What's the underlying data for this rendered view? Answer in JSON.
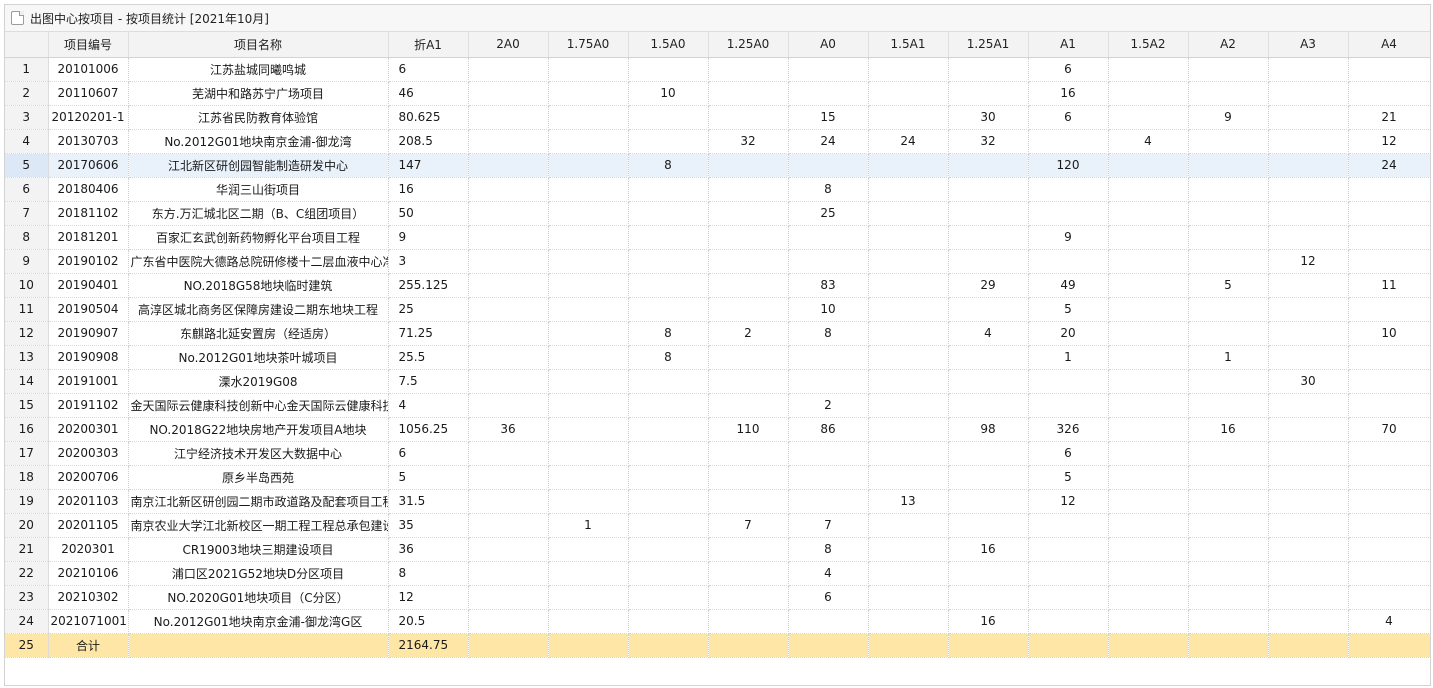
{
  "window": {
    "title": "出图中心按项目 - 按项目统计 [2021年10月]",
    "icon": "document-icon"
  },
  "columns": [
    "项目编号",
    "项目名称",
    "折A1",
    "2A0",
    "1.75A0",
    "1.5A0",
    "1.25A0",
    "A0",
    "1.5A1",
    "1.25A1",
    "A1",
    "1.5A2",
    "A2",
    "A3",
    "A4"
  ],
  "selected_row": 5,
  "rows": [
    {
      "rn": "1",
      "code": "20101006",
      "name": "江苏盐城同曦鸣城",
      "zhe": "6",
      "c2A0": "",
      "c175A0": "",
      "c15A0": "",
      "c125A0": "",
      "cA0": "",
      "c15A1": "",
      "c125A1": "",
      "cA1": "6",
      "c15A2": "",
      "cA2": "",
      "cA3": "",
      "cA4": ""
    },
    {
      "rn": "2",
      "code": "20110607",
      "name": "芜湖中和路苏宁广场项目",
      "zhe": "46",
      "c2A0": "",
      "c175A0": "",
      "c15A0": "10",
      "c125A0": "",
      "cA0": "",
      "c15A1": "",
      "c125A1": "",
      "cA1": "16",
      "c15A2": "",
      "cA2": "",
      "cA3": "",
      "cA4": ""
    },
    {
      "rn": "3",
      "code": "20120201-1",
      "name": "江苏省民防教育体验馆",
      "zhe": "80.625",
      "c2A0": "",
      "c175A0": "",
      "c15A0": "",
      "c125A0": "",
      "cA0": "15",
      "c15A1": "",
      "c125A1": "30",
      "cA1": "6",
      "c15A2": "",
      "cA2": "9",
      "cA3": "",
      "cA4": "21"
    },
    {
      "rn": "4",
      "code": "20130703",
      "name": "No.2012G01地块南京金浦-御龙湾",
      "zhe": "208.5",
      "c2A0": "",
      "c175A0": "",
      "c15A0": "",
      "c125A0": "32",
      "cA0": "24",
      "c15A1": "24",
      "c125A1": "32",
      "cA1": "",
      "c15A2": "4",
      "cA2": "",
      "cA3": "",
      "cA4": "12"
    },
    {
      "rn": "5",
      "code": "20170606",
      "name": "江北新区研创园智能制造研发中心",
      "zhe": "147",
      "c2A0": "",
      "c175A0": "",
      "c15A0": "8",
      "c125A0": "",
      "cA0": "",
      "c15A1": "",
      "c125A1": "",
      "cA1": "120",
      "c15A2": "",
      "cA2": "",
      "cA3": "",
      "cA4": "24"
    },
    {
      "rn": "6",
      "code": "20180406",
      "name": "华润三山街项目",
      "zhe": "16",
      "c2A0": "",
      "c175A0": "",
      "c15A0": "",
      "c125A0": "",
      "cA0": "8",
      "c15A1": "",
      "c125A1": "",
      "cA1": "",
      "c15A2": "",
      "cA2": "",
      "cA3": "",
      "cA4": ""
    },
    {
      "rn": "7",
      "code": "20181102",
      "name": "东方.万汇城北区二期（B、C组团项目）",
      "zhe": "50",
      "c2A0": "",
      "c175A0": "",
      "c15A0": "",
      "c125A0": "",
      "cA0": "25",
      "c15A1": "",
      "c125A1": "",
      "cA1": "",
      "c15A2": "",
      "cA2": "",
      "cA3": "",
      "cA4": ""
    },
    {
      "rn": "8",
      "code": "20181201",
      "name": "百家汇玄武创新药物孵化平台项目工程",
      "zhe": "9",
      "c2A0": "",
      "c175A0": "",
      "c15A0": "",
      "c125A0": "",
      "cA0": "",
      "c15A1": "",
      "c125A1": "",
      "cA1": "9",
      "c15A2": "",
      "cA2": "",
      "cA3": "",
      "cA4": ""
    },
    {
      "rn": "9",
      "code": "20190102",
      "name": "广东省中医院大德路总院研修楼十二层血液中心净",
      "zhe": "3",
      "c2A0": "",
      "c175A0": "",
      "c15A0": "",
      "c125A0": "",
      "cA0": "",
      "c15A1": "",
      "c125A1": "",
      "cA1": "",
      "c15A2": "",
      "cA2": "",
      "cA3": "12",
      "cA4": ""
    },
    {
      "rn": "10",
      "code": "20190401",
      "name": "NO.2018G58地块临时建筑",
      "zhe": "255.125",
      "c2A0": "",
      "c175A0": "",
      "c15A0": "",
      "c125A0": "",
      "cA0": "83",
      "c15A1": "",
      "c125A1": "29",
      "cA1": "49",
      "c15A2": "",
      "cA2": "5",
      "cA3": "",
      "cA4": "11"
    },
    {
      "rn": "11",
      "code": "20190504",
      "name": "高淳区城北商务区保障房建设二期东地块工程",
      "zhe": "25",
      "c2A0": "",
      "c175A0": "",
      "c15A0": "",
      "c125A0": "",
      "cA0": "10",
      "c15A1": "",
      "c125A1": "",
      "cA1": "5",
      "c15A2": "",
      "cA2": "",
      "cA3": "",
      "cA4": ""
    },
    {
      "rn": "12",
      "code": "20190907",
      "name": "东麒路北延安置房（经适房）",
      "zhe": "71.25",
      "c2A0": "",
      "c175A0": "",
      "c15A0": "8",
      "c125A0": "2",
      "cA0": "8",
      "c15A1": "",
      "c125A1": "4",
      "cA1": "20",
      "c15A2": "",
      "cA2": "",
      "cA3": "",
      "cA4": "10"
    },
    {
      "rn": "13",
      "code": "20190908",
      "name": "No.2012G01地块茶叶城项目",
      "zhe": "25.5",
      "c2A0": "",
      "c175A0": "",
      "c15A0": "8",
      "c125A0": "",
      "cA0": "",
      "c15A1": "",
      "c125A1": "",
      "cA1": "1",
      "c15A2": "",
      "cA2": "1",
      "cA3": "",
      "cA4": ""
    },
    {
      "rn": "14",
      "code": "20191001",
      "name": "溧水2019G08",
      "zhe": "7.5",
      "c2A0": "",
      "c175A0": "",
      "c15A0": "",
      "c125A0": "",
      "cA0": "",
      "c15A1": "",
      "c125A1": "",
      "cA1": "",
      "c15A2": "",
      "cA2": "",
      "cA3": "30",
      "cA4": ""
    },
    {
      "rn": "15",
      "code": "20191102",
      "name": "金天国际云健康科技创新中心金天国际云健康科技",
      "zhe": "4",
      "c2A0": "",
      "c175A0": "",
      "c15A0": "",
      "c125A0": "",
      "cA0": "2",
      "c15A1": "",
      "c125A1": "",
      "cA1": "",
      "c15A2": "",
      "cA2": "",
      "cA3": "",
      "cA4": ""
    },
    {
      "rn": "16",
      "code": "20200301",
      "name": "NO.2018G22地块房地产开发项目A地块",
      "zhe": "1056.25",
      "c2A0": "36",
      "c175A0": "",
      "c15A0": "",
      "c125A0": "110",
      "cA0": "86",
      "c15A1": "",
      "c125A1": "98",
      "cA1": "326",
      "c15A2": "",
      "cA2": "16",
      "cA3": "",
      "cA4": "70"
    },
    {
      "rn": "17",
      "code": "20200303",
      "name": "江宁经济技术开发区大数据中心",
      "zhe": "6",
      "c2A0": "",
      "c175A0": "",
      "c15A0": "",
      "c125A0": "",
      "cA0": "",
      "c15A1": "",
      "c125A1": "",
      "cA1": "6",
      "c15A2": "",
      "cA2": "",
      "cA3": "",
      "cA4": ""
    },
    {
      "rn": "18",
      "code": "20200706",
      "name": "原乡半岛西苑",
      "zhe": "5",
      "c2A0": "",
      "c175A0": "",
      "c15A0": "",
      "c125A0": "",
      "cA0": "",
      "c15A1": "",
      "c125A1": "",
      "cA1": "5",
      "c15A2": "",
      "cA2": "",
      "cA3": "",
      "cA4": ""
    },
    {
      "rn": "19",
      "code": "20201103",
      "name": "南京江北新区研创园二期市政道路及配套项目工程",
      "zhe": "31.5",
      "c2A0": "",
      "c175A0": "",
      "c15A0": "",
      "c125A0": "",
      "cA0": "",
      "c15A1": "13",
      "c125A1": "",
      "cA1": "12",
      "c15A2": "",
      "cA2": "",
      "cA3": "",
      "cA4": ""
    },
    {
      "rn": "20",
      "code": "20201105",
      "name": "南京农业大学江北新校区一期工程工程总承包建设",
      "zhe": "35",
      "c2A0": "",
      "c175A0": "1",
      "c15A0": "",
      "c125A0": "7",
      "cA0": "7",
      "c15A1": "",
      "c125A1": "",
      "cA1": "",
      "c15A2": "",
      "cA2": "",
      "cA3": "",
      "cA4": ""
    },
    {
      "rn": "21",
      "code": "2020301",
      "name": "CR19003地块三期建设项目",
      "zhe": "36",
      "c2A0": "",
      "c175A0": "",
      "c15A0": "",
      "c125A0": "",
      "cA0": "8",
      "c15A1": "",
      "c125A1": "16",
      "cA1": "",
      "c15A2": "",
      "cA2": "",
      "cA3": "",
      "cA4": ""
    },
    {
      "rn": "22",
      "code": "20210106",
      "name": "浦口区2021G52地块D分区项目",
      "zhe": "8",
      "c2A0": "",
      "c175A0": "",
      "c15A0": "",
      "c125A0": "",
      "cA0": "4",
      "c15A1": "",
      "c125A1": "",
      "cA1": "",
      "c15A2": "",
      "cA2": "",
      "cA3": "",
      "cA4": ""
    },
    {
      "rn": "23",
      "code": "20210302",
      "name": "NO.2020G01地块项目（C分区）",
      "zhe": "12",
      "c2A0": "",
      "c175A0": "",
      "c15A0": "",
      "c125A0": "",
      "cA0": "6",
      "c15A1": "",
      "c125A1": "",
      "cA1": "",
      "c15A2": "",
      "cA2": "",
      "cA3": "",
      "cA4": ""
    },
    {
      "rn": "24",
      "code": "2021071001",
      "name": "No.2012G01地块南京金浦-御龙湾G区",
      "zhe": "20.5",
      "c2A0": "",
      "c175A0": "",
      "c15A0": "",
      "c125A0": "",
      "cA0": "",
      "c15A1": "",
      "c125A1": "16",
      "cA1": "",
      "c15A2": "",
      "cA2": "",
      "cA3": "",
      "cA4": "4"
    }
  ],
  "total": {
    "rn": "25",
    "code": "合计",
    "name": "",
    "zhe": "2164.75",
    "c2A0": "",
    "c175A0": "",
    "c15A0": "",
    "c125A0": "",
    "cA0": "",
    "c15A1": "",
    "c125A1": "",
    "cA1": "",
    "c15A2": "",
    "cA2": "",
    "cA3": "",
    "cA4": ""
  },
  "colors": {
    "selected_row_bg": "#e9f1fb",
    "total_row_bg": "#fde6a6",
    "header_bg": "#f3f3f3"
  }
}
